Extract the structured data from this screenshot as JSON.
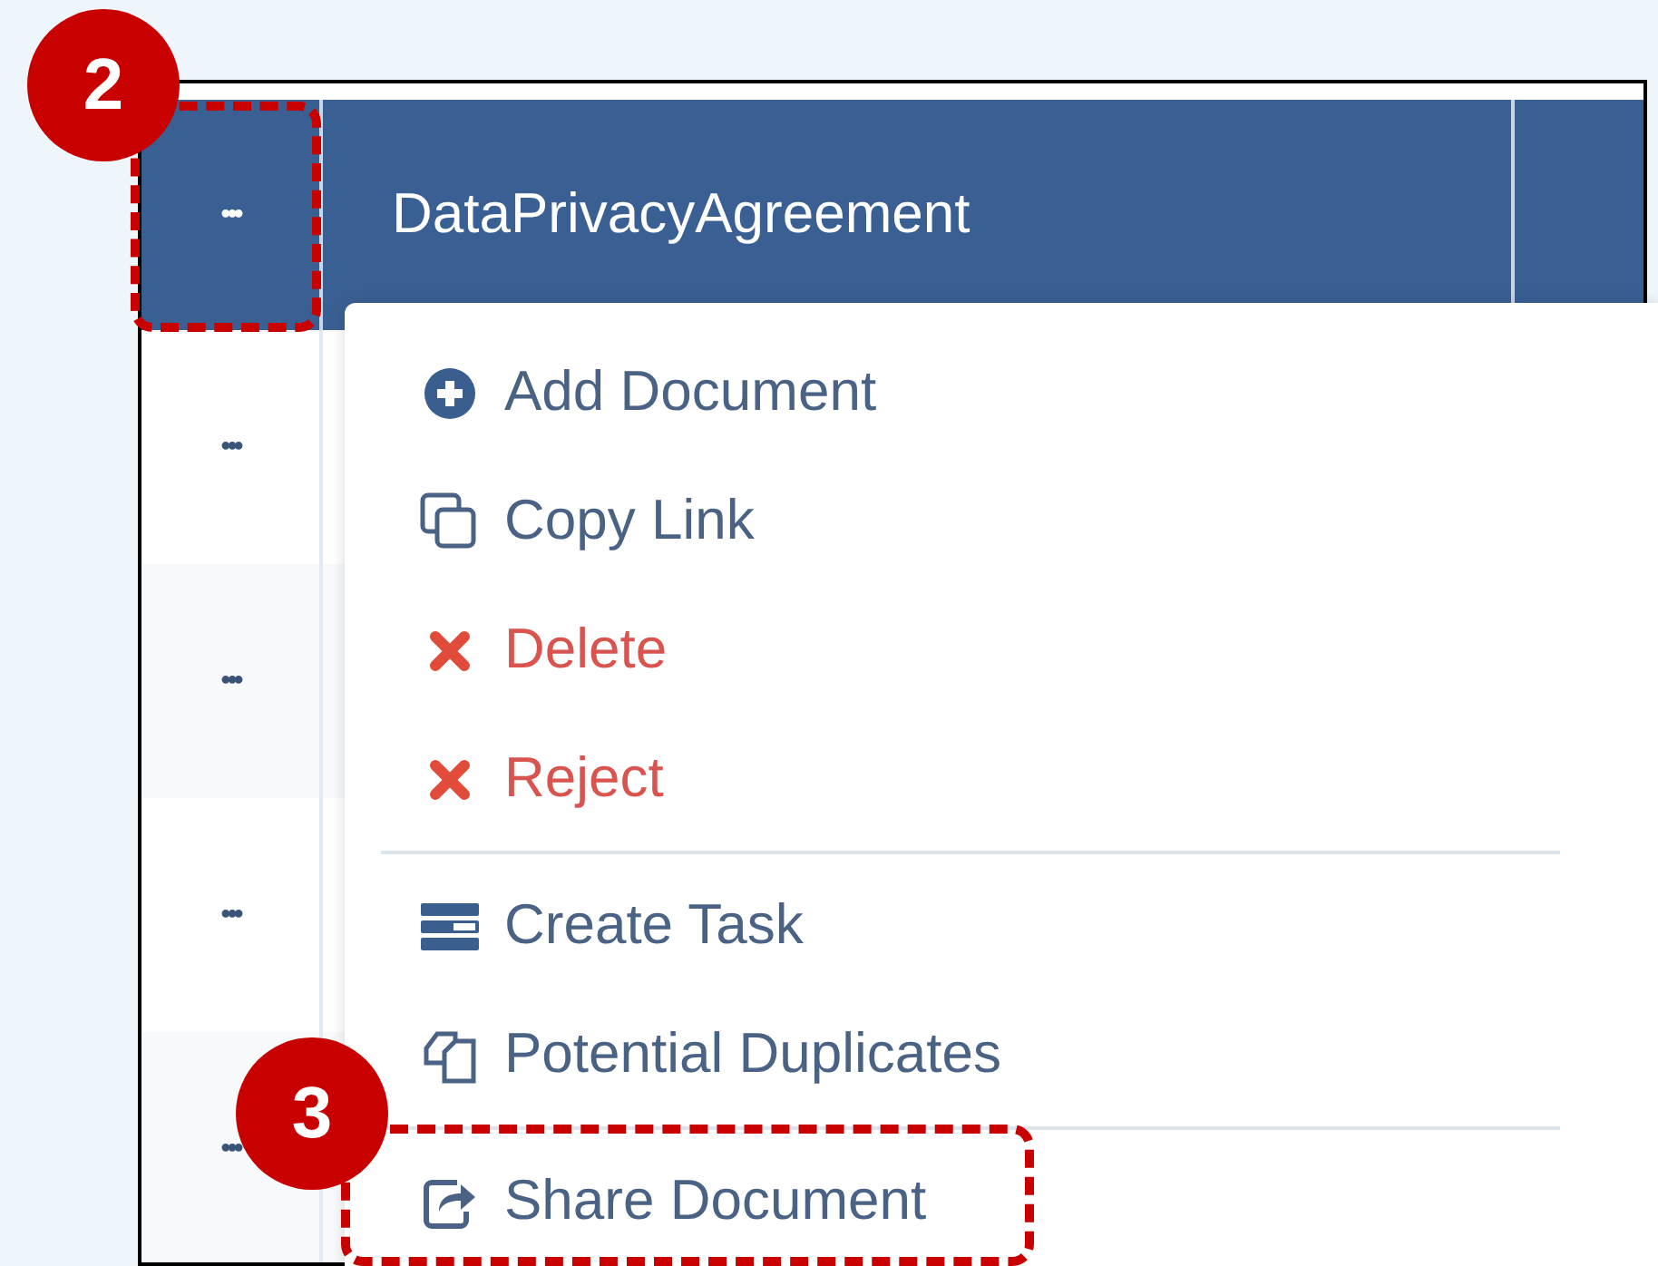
{
  "header": {
    "menu_button": "•••",
    "title": "DataPrivacyAgreement"
  },
  "rows": [
    {
      "menu_button": "•••"
    },
    {
      "menu_button": "•••"
    },
    {
      "menu_button": "•••"
    },
    {
      "menu_button": "•••"
    }
  ],
  "menu": {
    "groups": [
      [
        {
          "label": "Add Document",
          "kind": "add"
        },
        {
          "label": "Copy Link",
          "kind": "copy"
        },
        {
          "label": "Delete",
          "kind": "danger"
        },
        {
          "label": "Reject",
          "kind": "danger"
        }
      ],
      [
        {
          "label": "Create Task",
          "kind": "task"
        },
        {
          "label": "Potential Duplicates",
          "kind": "duplicates"
        }
      ],
      [
        {
          "label": "Share Document",
          "kind": "share"
        }
      ]
    ]
  },
  "callouts": [
    {
      "number": "2"
    },
    {
      "number": "3"
    }
  ]
}
